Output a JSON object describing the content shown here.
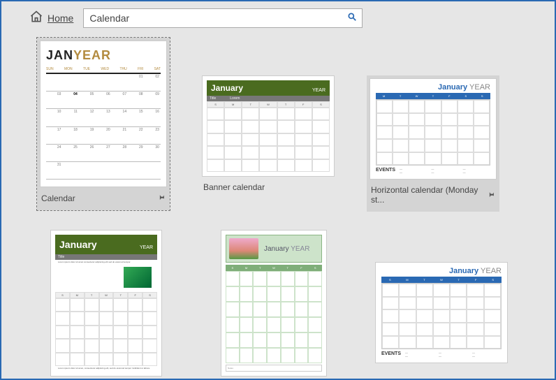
{
  "topbar": {
    "home_label": "Home",
    "search_value": "Calendar"
  },
  "templates": [
    {
      "label": "Calendar",
      "selected": true,
      "pin": true,
      "thumb": {
        "kind": "janyear",
        "month": "JAN",
        "year": "YEAR",
        "days": [
          "SUN",
          "MON",
          "TUE",
          "WED",
          "THU",
          "FRI",
          "SAT"
        ],
        "weeks": [
          [
            "",
            "",
            "",
            "",
            "",
            "01",
            "02"
          ],
          [
            "03",
            "04",
            "05",
            "06",
            "07",
            "08",
            "09"
          ],
          [
            "10",
            "11",
            "12",
            "13",
            "14",
            "15",
            "16"
          ],
          [
            "17",
            "18",
            "19",
            "20",
            "21",
            "22",
            "23"
          ],
          [
            "24",
            "25",
            "26",
            "27",
            "28",
            "29",
            "30"
          ],
          [
            "31",
            "",
            "",
            "",
            "",
            "",
            ""
          ]
        ]
      }
    },
    {
      "label": "Banner calendar",
      "thumb": {
        "kind": "banner-land",
        "month": "January",
        "year": "YEAR",
        "sub_left": "Title",
        "sub_right": "Lorem"
      }
    },
    {
      "label": "Horizontal calendar (Monday st...",
      "hovered": true,
      "pin": true,
      "thumb": {
        "kind": "horizontal",
        "month": "January",
        "year": "YEAR",
        "events_label": "EVENTS"
      }
    },
    {
      "label": "",
      "thumb": {
        "kind": "banner-port",
        "month": "January",
        "year": "YEAR"
      }
    },
    {
      "label": "",
      "thumb": {
        "kind": "family",
        "month": "January",
        "year": "YEAR"
      }
    },
    {
      "label": "",
      "thumb": {
        "kind": "horizontal",
        "month": "January",
        "year": "YEAR",
        "events_label": "EVENTS"
      }
    }
  ]
}
